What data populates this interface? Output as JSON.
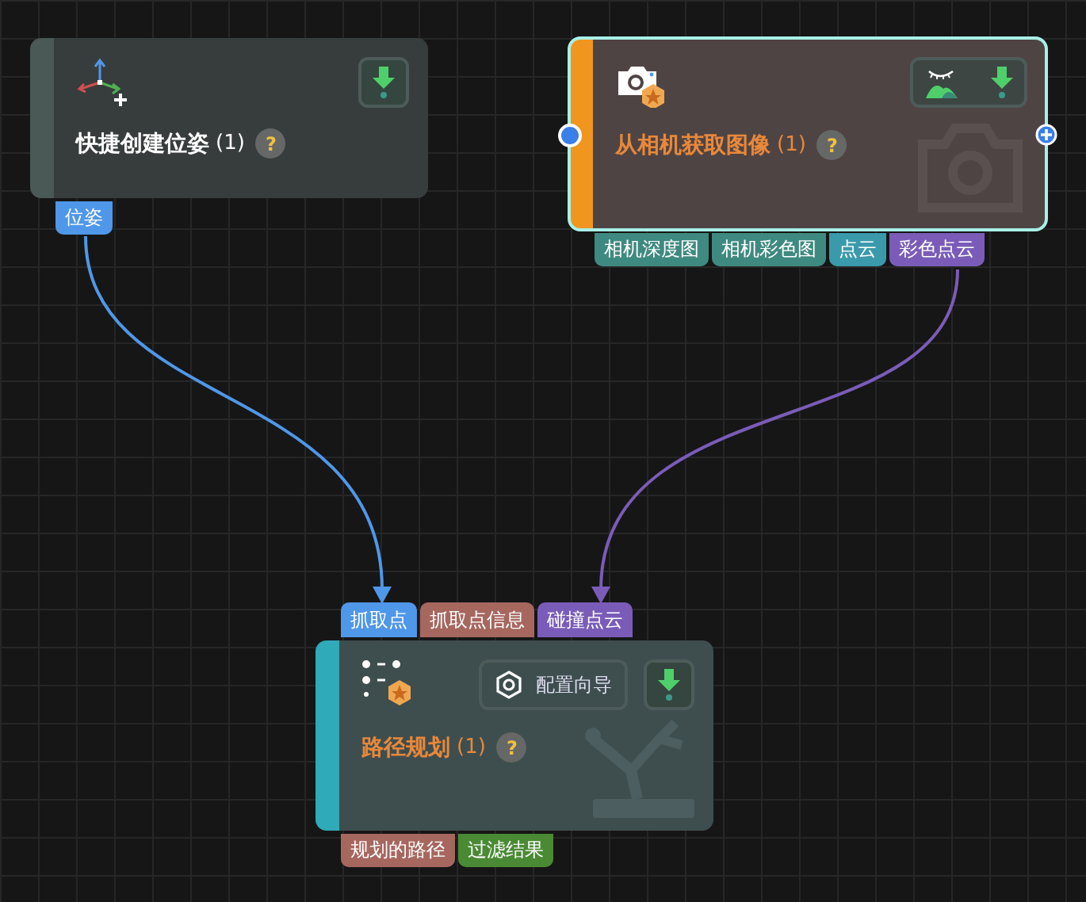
{
  "nodes": [
    {
      "kind": "pose",
      "title": "快捷创建位姿",
      "count": "(1)",
      "help": "?",
      "selected": false,
      "outputs": [
        {
          "label": "位姿",
          "color": "#4f97e8"
        }
      ]
    },
    {
      "kind": "camera",
      "title": "从相机获取图像",
      "count": "(1)",
      "help": "?",
      "selected": true,
      "outputs": [
        {
          "label": "相机深度图",
          "color": "#3f8a80"
        },
        {
          "label": "相机彩色图",
          "color": "#3f8a80"
        },
        {
          "label": "点云",
          "color": "#3a9aab"
        },
        {
          "label": "彩色点云",
          "color": "#7a5cb8"
        }
      ]
    },
    {
      "kind": "path",
      "title": "路径规划",
      "count": "(1)",
      "help": "?",
      "selected": false,
      "wizard": "配置向导",
      "inputs": [
        {
          "label": "抓取点",
          "color": "#4f97e8"
        },
        {
          "label": "抓取点信息",
          "color": "#a6675f"
        },
        {
          "label": "碰撞点云",
          "color": "#7a5cb8"
        }
      ],
      "outputs": [
        {
          "label": "规划的路径",
          "color": "#a6675f"
        },
        {
          "label": "过滤结果",
          "color": "#4a8a34"
        }
      ]
    }
  ]
}
